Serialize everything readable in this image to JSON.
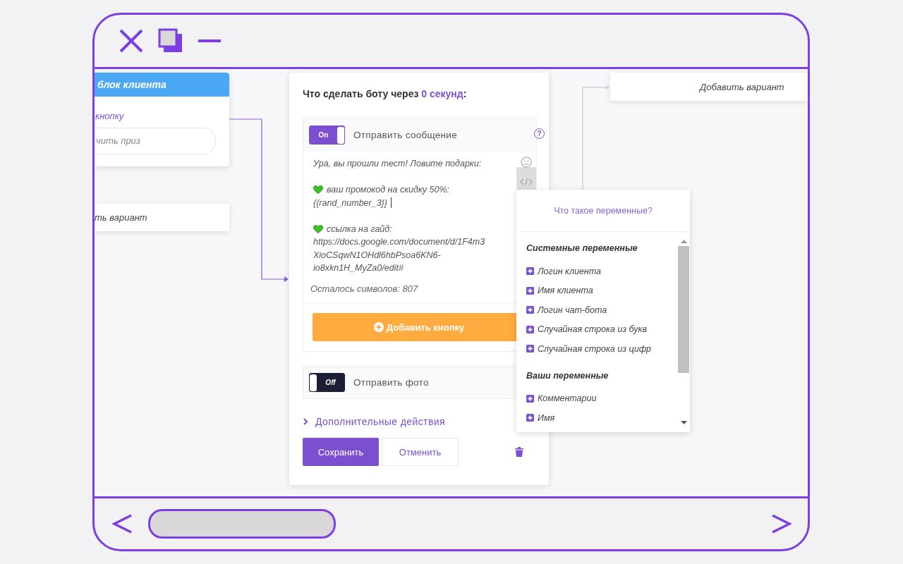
{
  "canvas": {
    "client_block": {
      "title": "блок клиента",
      "link": "кнопку",
      "field_value": "чить приз"
    },
    "variant_card_left": {
      "label": "ть вариант"
    },
    "variant_card_right": {
      "label": "Добавить вариант"
    },
    "panel": {
      "heading": {
        "text": "Что сделать боту через",
        "delay": "0 секунд",
        "end": ":"
      },
      "message_toggle": {
        "label": "Отправить сообщение",
        "on": true,
        "text": "On"
      },
      "help_glyph": "?",
      "message": [
        {
          "kind": "plain",
          "lines": [
            {
              "text": "Ура, вы прошли тест! Ловите подарки:",
              "cursor": false
            }
          ]
        },
        {
          "kind": "heart",
          "lines": [
            {
              "text": "ваш промокод на скидку 50%:",
              "cursor": false
            },
            {
              "text": "{{rand_number_3}}",
              "cursor": true
            }
          ]
        },
        {
          "kind": "heart",
          "lines": [
            {
              "text": "ссылка на гайд:",
              "cursor": false
            },
            {
              "text": "https://docs.google.com/document/d/1F4m3",
              "cursor": false
            },
            {
              "text": "XioCSqwN1OHdl6hbPsoa6KN6-",
              "cursor": false
            },
            {
              "text": "io8xkn1H_MyZa0/edit#",
              "cursor": false
            }
          ]
        }
      ],
      "counter": "Осталось символов: 807",
      "add_button": "Добавить кнопку",
      "photo_toggle": {
        "label": "Отправить фото",
        "on": false,
        "text": "Off"
      },
      "more_actions": {
        "label": "Дополнительные действия",
        "expanded": false
      },
      "save": "Сохранить",
      "cancel": "Отменить"
    },
    "variables": {
      "link": "Что такое переменные?",
      "groups": [
        {
          "title": "Системные переменные",
          "items": [
            "Логин клиента",
            "Имя клиента",
            "Логин чат-бота",
            "Случайная строка из букв",
            "Случайная строка из цифр"
          ]
        },
        {
          "title": "Ваши переменные",
          "items": [
            "Комментарии",
            "Имя"
          ]
        }
      ]
    }
  }
}
